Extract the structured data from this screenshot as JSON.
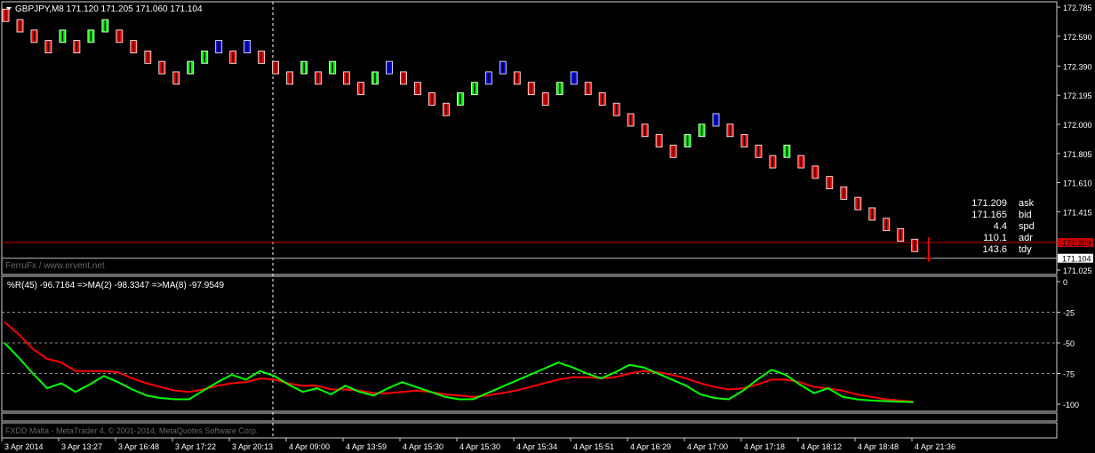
{
  "chart_data": [
    {
      "type": "renko",
      "symbol_header": "GBPJPY,M8  171.120 171.205 171.060 171.104",
      "watermark": "FerruFx / www.ervent.net",
      "y_ticks": [
        "172.785",
        "172.590",
        "172.390",
        "172.195",
        "172.000",
        "171.805",
        "171.610",
        "171.415",
        "171.025"
      ],
      "ylim": [
        171.025,
        172.785
      ],
      "ask_line": {
        "value": 171.209,
        "label": "171.209",
        "color": "#cc0000"
      },
      "last_price": {
        "value": 171.104,
        "label": "171.104"
      },
      "bricks": [
        {
          "v": 172.73,
          "c": "r"
        },
        {
          "v": 172.66,
          "c": "r"
        },
        {
          "v": 172.59,
          "c": "r"
        },
        {
          "v": 172.52,
          "c": "r"
        },
        {
          "v": 172.59,
          "c": "g"
        },
        {
          "v": 172.52,
          "c": "r"
        },
        {
          "v": 172.59,
          "c": "g"
        },
        {
          "v": 172.66,
          "c": "g"
        },
        {
          "v": 172.59,
          "c": "r"
        },
        {
          "v": 172.52,
          "c": "r"
        },
        {
          "v": 172.45,
          "c": "r"
        },
        {
          "v": 172.38,
          "c": "r"
        },
        {
          "v": 172.31,
          "c": "r"
        },
        {
          "v": 172.38,
          "c": "g"
        },
        {
          "v": 172.45,
          "c": "g"
        },
        {
          "v": 172.52,
          "c": "b"
        },
        {
          "v": 172.45,
          "c": "r"
        },
        {
          "v": 172.52,
          "c": "b"
        },
        {
          "v": 172.45,
          "c": "r"
        },
        {
          "v": 172.38,
          "c": "r"
        },
        {
          "v": 172.31,
          "c": "r"
        },
        {
          "v": 172.38,
          "c": "g"
        },
        {
          "v": 172.31,
          "c": "r"
        },
        {
          "v": 172.38,
          "c": "g"
        },
        {
          "v": 172.31,
          "c": "r"
        },
        {
          "v": 172.24,
          "c": "r"
        },
        {
          "v": 172.31,
          "c": "g"
        },
        {
          "v": 172.38,
          "c": "b"
        },
        {
          "v": 172.31,
          "c": "r"
        },
        {
          "v": 172.24,
          "c": "r"
        },
        {
          "v": 172.17,
          "c": "r"
        },
        {
          "v": 172.1,
          "c": "r"
        },
        {
          "v": 172.17,
          "c": "g"
        },
        {
          "v": 172.24,
          "c": "g"
        },
        {
          "v": 172.31,
          "c": "b"
        },
        {
          "v": 172.38,
          "c": "b"
        },
        {
          "v": 172.31,
          "c": "r"
        },
        {
          "v": 172.24,
          "c": "r"
        },
        {
          "v": 172.17,
          "c": "r"
        },
        {
          "v": 172.24,
          "c": "g"
        },
        {
          "v": 172.31,
          "c": "b"
        },
        {
          "v": 172.24,
          "c": "r"
        },
        {
          "v": 172.17,
          "c": "r"
        },
        {
          "v": 172.1,
          "c": "r"
        },
        {
          "v": 172.03,
          "c": "r"
        },
        {
          "v": 171.96,
          "c": "r"
        },
        {
          "v": 171.89,
          "c": "r"
        },
        {
          "v": 171.82,
          "c": "r"
        },
        {
          "v": 171.89,
          "c": "g"
        },
        {
          "v": 171.96,
          "c": "g"
        },
        {
          "v": 172.03,
          "c": "b"
        },
        {
          "v": 171.96,
          "c": "r"
        },
        {
          "v": 171.89,
          "c": "r"
        },
        {
          "v": 171.82,
          "c": "r"
        },
        {
          "v": 171.75,
          "c": "r"
        },
        {
          "v": 171.82,
          "c": "g"
        },
        {
          "v": 171.75,
          "c": "r"
        },
        {
          "v": 171.68,
          "c": "r"
        },
        {
          "v": 171.61,
          "c": "r"
        },
        {
          "v": 171.54,
          "c": "r"
        },
        {
          "v": 171.47,
          "c": "r"
        },
        {
          "v": 171.4,
          "c": "r"
        },
        {
          "v": 171.33,
          "c": "r"
        },
        {
          "v": 171.26,
          "c": "r"
        },
        {
          "v": 171.19,
          "c": "r"
        }
      ],
      "info_box": [
        {
          "value": "171.209",
          "label": "ask"
        },
        {
          "value": "171.165",
          "label": "bid"
        },
        {
          "value": "4.4",
          "label": "spd"
        },
        {
          "value": "110.1",
          "label": "adr"
        },
        {
          "value": "143.6",
          "label": "tdy"
        }
      ],
      "colors": {
        "down": "#ff0000",
        "up": "#00ff00",
        "up_strong": "#0000ff"
      }
    },
    {
      "type": "line",
      "header": "%R(45) -96.7164  =>MA(2) -98.3347  =>MA(8) -97.9549",
      "y_ticks": [
        "0",
        "-25",
        "-50",
        "-75",
        "-100"
      ],
      "ylim": [
        -100,
        0
      ],
      "series": [
        {
          "color": "#00ff00",
          "values": [
            -50,
            -62,
            -75,
            -87,
            -83,
            -90,
            -84,
            -77,
            -82,
            -88,
            -93,
            -95,
            -96,
            -96,
            -89,
            -82,
            -76,
            -80,
            -73,
            -77,
            -84,
            -90,
            -87,
            -92,
            -85,
            -90,
            -93,
            -87,
            -82,
            -86,
            -90,
            -94,
            -96,
            -96,
            -91,
            -86,
            -81,
            -76,
            -71,
            -66,
            -70,
            -75,
            -79,
            -74,
            -68,
            -70,
            -75,
            -80,
            -85,
            -92,
            -95,
            -96,
            -89,
            -80,
            -72,
            -76,
            -84,
            -91,
            -87,
            -94,
            -96,
            -97,
            -97.5,
            -98,
            -98.3
          ]
        },
        {
          "color": "#ff0000",
          "values": [
            -33,
            -43,
            -55,
            -63,
            -66,
            -73,
            -73,
            -73,
            -74,
            -79,
            -83,
            -86,
            -89,
            -90,
            -88,
            -85,
            -83,
            -82,
            -79,
            -80,
            -83,
            -85,
            -85,
            -88,
            -88,
            -89,
            -91,
            -91,
            -90,
            -89,
            -90,
            -92,
            -93,
            -94,
            -93,
            -91,
            -89,
            -86,
            -83,
            -80,
            -78,
            -78,
            -79,
            -78,
            -75,
            -73,
            -74,
            -76,
            -79,
            -83,
            -86,
            -88,
            -87,
            -84,
            -80,
            -80,
            -82,
            -86,
            -87,
            -89,
            -92,
            -94,
            -96,
            -97,
            -97.9
          ]
        }
      ]
    }
  ],
  "footer": {
    "broker": "FXDD Malta - MetaTrader 4, © 2001-2014, MetaQuotes Software Corp.",
    "x_ticks": [
      "3 Apr 2014",
      "3 Apr 13:27",
      "3 Apr 16:48",
      "3 Apr 17:22",
      "3 Apr 20:13",
      "4 Apr 09:00",
      "4 Apr 13:59",
      "4 Apr 15:30",
      "4 Apr 15:30",
      "4 Apr 15:34",
      "4 Apr 15:51",
      "4 Apr 16:29",
      "4 Apr 17:00",
      "4 Apr 17:18",
      "4 Apr 18:12",
      "4 Apr 18:48",
      "4 Apr 21:36"
    ]
  }
}
